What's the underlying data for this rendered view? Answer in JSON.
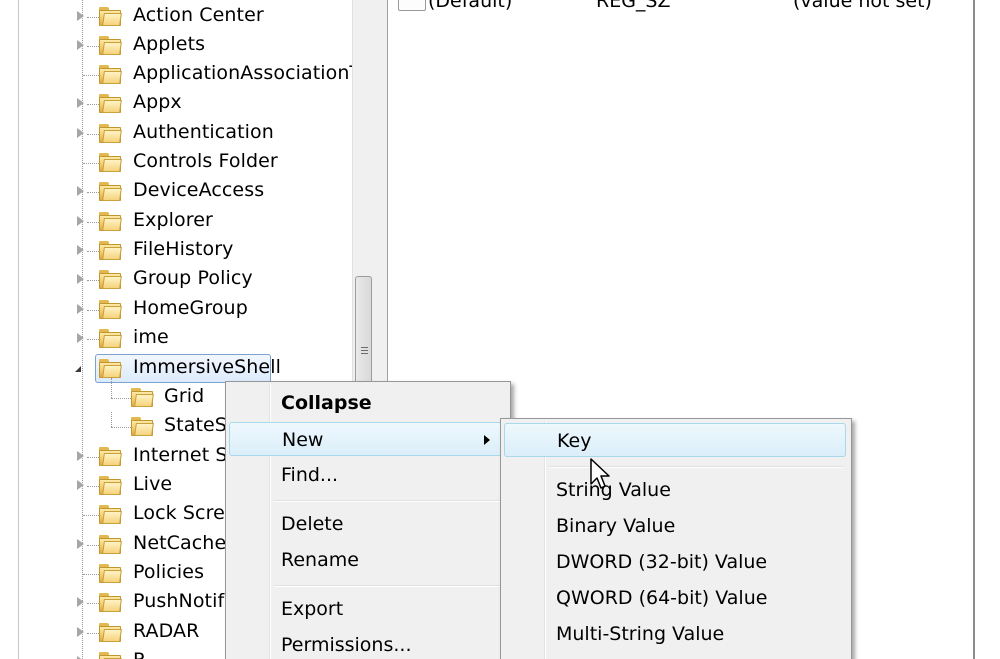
{
  "tree": {
    "items": [
      {
        "label": "Action Center",
        "expandable": true
      },
      {
        "label": "Applets",
        "expandable": true
      },
      {
        "label": "ApplicationAssociationTo",
        "expandable": false
      },
      {
        "label": "Appx",
        "expandable": true
      },
      {
        "label": "Authentication",
        "expandable": true
      },
      {
        "label": "Controls Folder",
        "expandable": false
      },
      {
        "label": "DeviceAccess",
        "expandable": true
      },
      {
        "label": "Explorer",
        "expandable": true
      },
      {
        "label": "FileHistory",
        "expandable": true
      },
      {
        "label": "Group Policy",
        "expandable": true
      },
      {
        "label": "HomeGroup",
        "expandable": true
      },
      {
        "label": "ime",
        "expandable": true
      },
      {
        "label": "ImmersiveShell",
        "expandable": true,
        "expanded": true,
        "selected": true
      },
      {
        "label": "Grid",
        "child": true
      },
      {
        "label": "StateSt",
        "child": true
      },
      {
        "label": "Internet Se",
        "expandable": true
      },
      {
        "label": "Live",
        "expandable": true
      },
      {
        "label": "Lock Scree",
        "expandable": false
      },
      {
        "label": "NetCache",
        "expandable": true
      },
      {
        "label": "Policies",
        "expandable": false
      },
      {
        "label": "PushNotifi",
        "expandable": true
      },
      {
        "label": "RADAR",
        "expandable": true
      },
      {
        "label": "R",
        "expandable": true
      }
    ]
  },
  "values_pane": {
    "row": {
      "name": "(Default)",
      "type": "REG_SZ",
      "data": "(value not set)"
    }
  },
  "context_menu": {
    "items": [
      {
        "label": "Collapse",
        "bold": true
      },
      {
        "label": "New",
        "submenu": true,
        "highlighted": true
      },
      {
        "label": "Find..."
      },
      {
        "separator": true
      },
      {
        "label": "Delete"
      },
      {
        "label": "Rename"
      },
      {
        "separator": true
      },
      {
        "label": "Export"
      },
      {
        "label": "Permissions..."
      }
    ]
  },
  "submenu": {
    "items": [
      {
        "label": "Key",
        "highlighted": true
      },
      {
        "separator": true
      },
      {
        "label": "String Value"
      },
      {
        "label": "Binary Value"
      },
      {
        "label": "DWORD (32-bit) Value"
      },
      {
        "label": "QWORD (64-bit) Value"
      },
      {
        "label": "Multi-String Value"
      }
    ]
  },
  "icons": {
    "folder": "folder-icon",
    "expander": "chevron-right-icon",
    "collapse": "chevron-down-icon",
    "value": "registry-value-icon",
    "cursor": "mouse-pointer-icon"
  },
  "colors": {
    "selection_border": "#7da2ce",
    "menu_hover_border": "#a8d8eb",
    "menu_background": "#f0f0f0"
  }
}
